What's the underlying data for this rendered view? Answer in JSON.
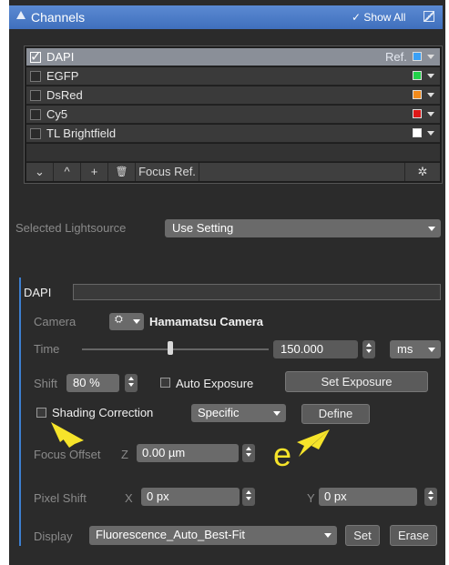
{
  "panel": {
    "title": "Channels",
    "show_all": "✓ Show All"
  },
  "channels": [
    {
      "name": "DAPI",
      "checked": true,
      "ref": "Ref.",
      "color": "#3aa0f5"
    },
    {
      "name": "EGFP",
      "checked": false,
      "ref": "",
      "color": "#22d24a"
    },
    {
      "name": "DsRed",
      "checked": false,
      "ref": "",
      "color": "#f08a1c"
    },
    {
      "name": "Cy5",
      "checked": false,
      "ref": "",
      "color": "#e01818"
    },
    {
      "name": "TL Brightfield",
      "checked": false,
      "ref": "",
      "color": "#ffffff"
    }
  ],
  "toolbar": {
    "move_down": "⌄",
    "move_up": "^",
    "add": "+",
    "delete": "🗑",
    "focus_ref": "Focus Ref.",
    "settings": "✲"
  },
  "lightsource": {
    "label": "Selected Lightsource",
    "value": "Use Setting"
  },
  "dapi": {
    "section_label": "DAPI",
    "camera_label": "Camera",
    "camera_name": "Hamamatsu Camera",
    "time_label": "Time",
    "time_value": "150.000",
    "time_unit": "ms",
    "time_slider_fraction": 0.47,
    "shift_label": "Shift",
    "shift_value": "80 %",
    "auto_exposure_label": "Auto Exposure",
    "set_exposure_label": "Set Exposure",
    "shading_label": "Shading Correction",
    "shading_mode": "Specific",
    "define_label": "Define",
    "focus_offset_label": "Focus Offset",
    "focus_axis": "Z",
    "focus_value": "0.00 µm",
    "pixel_shift_label": "Pixel Shift",
    "px_x_label": "X",
    "px_x_value": "0 px",
    "px_y_label": "Y",
    "px_y_value": "0 px",
    "display_label": "Display",
    "display_value": "Fluorescence_Auto_Best-Fit",
    "set_label": "Set",
    "erase_label": "Erase"
  },
  "annotation": {
    "letter": "e",
    "color": "#f6e42a"
  }
}
